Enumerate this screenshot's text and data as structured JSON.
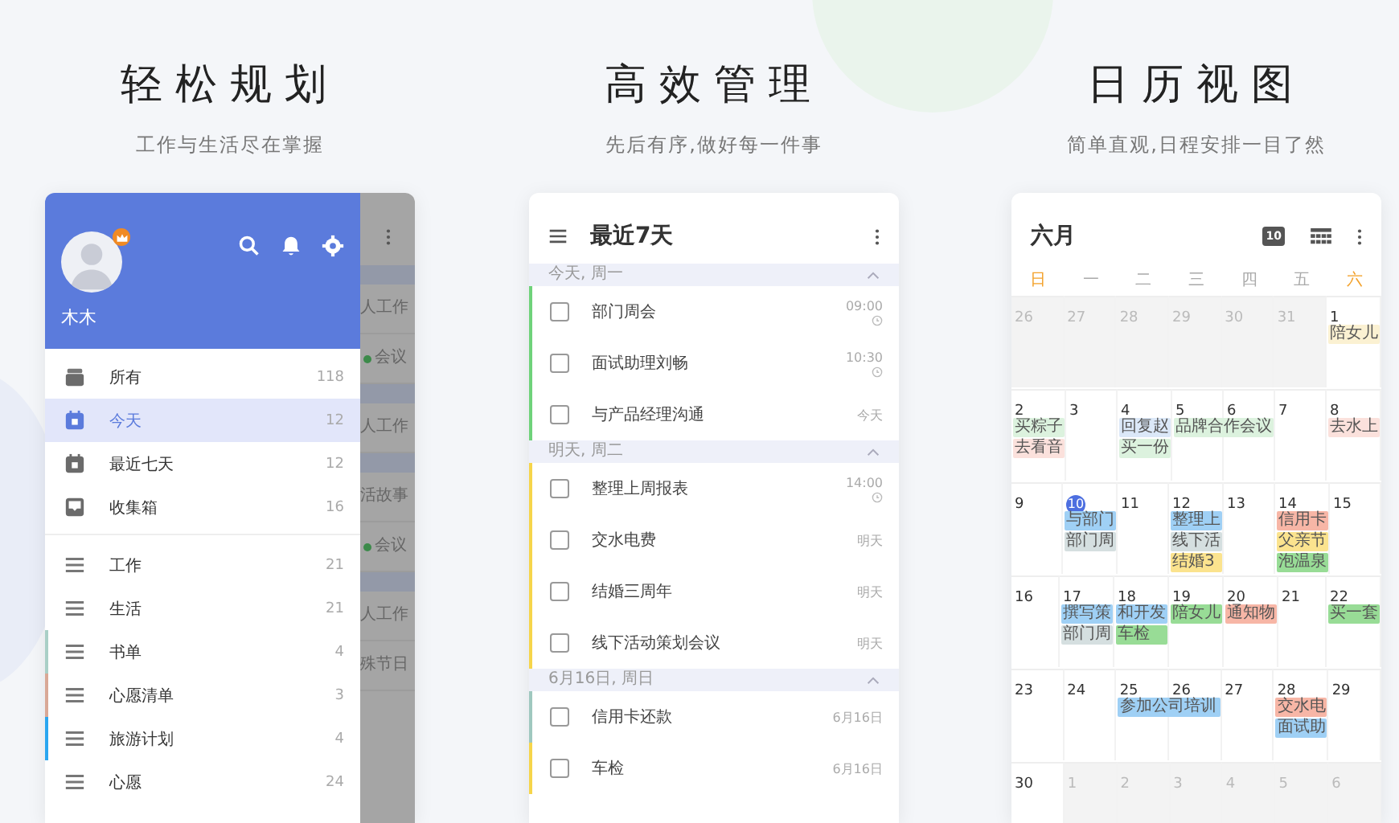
{
  "panels": [
    {
      "title": "轻松规划",
      "subtitle": "工作与生活尽在掌握"
    },
    {
      "title": "高效管理",
      "subtitle": "先后有序,做好每一件事"
    },
    {
      "title": "日历视图",
      "subtitle": "简单直观,日程安排一目了然"
    }
  ],
  "drawer": {
    "user_name": "木木",
    "premium_badge": true,
    "items": [
      {
        "kind": "tray",
        "label": "所有",
        "count": "118",
        "selected": false
      },
      {
        "kind": "calendar",
        "label": "今天",
        "count": "12",
        "selected": true
      },
      {
        "kind": "calendar",
        "label": "最近七天",
        "count": "12",
        "selected": false
      },
      {
        "kind": "inbox",
        "label": "收集箱",
        "count": "16",
        "selected": false
      }
    ],
    "lists": [
      {
        "label": "工作",
        "count": "21"
      },
      {
        "label": "生活",
        "count": "21"
      },
      {
        "label": "书单",
        "count": "4",
        "color": "#a9cfc6"
      },
      {
        "label": "心愿清单",
        "count": "3",
        "color": "#d9a896"
      },
      {
        "label": "旅游计划",
        "count": "4",
        "color": "#2aa6f0"
      },
      {
        "label": "心愿",
        "count": "24"
      }
    ],
    "behind": [
      {
        "kind": "header"
      },
      {
        "kind": "row",
        "text": "人工作"
      },
      {
        "kind": "tag",
        "text": "会议",
        "color": "#3c8a4a"
      },
      {
        "kind": "header"
      },
      {
        "kind": "row",
        "text": "人工作"
      },
      {
        "kind": "header"
      },
      {
        "kind": "row",
        "text": "活故事"
      },
      {
        "kind": "tag",
        "text": "会议",
        "color": "#3c8a4a"
      },
      {
        "kind": "header"
      },
      {
        "kind": "row",
        "text": "人工作"
      },
      {
        "kind": "row",
        "text": "殊节日"
      }
    ]
  },
  "tasks_view": {
    "title": "最近7天",
    "sections": [
      {
        "title": "今天, 周一",
        "expanded": true,
        "tasks": [
          {
            "title": "部门周会",
            "due": "09:00",
            "reminder": true,
            "checked": false,
            "color": "#6fd27a"
          },
          {
            "title": "面试助理刘畅",
            "due": "10:30",
            "reminder": true,
            "checked": false,
            "color": "#6fd27a"
          },
          {
            "title": "与产品经理沟通",
            "due": "今天",
            "reminder": false,
            "checked": false,
            "color": "#6fd27a"
          }
        ]
      },
      {
        "title": "明天, 周二",
        "expanded": true,
        "tasks": [
          {
            "title": "整理上周报表",
            "due": "14:00",
            "reminder": true,
            "checked": false,
            "color": "#f6d54a"
          },
          {
            "title": "交水电费",
            "due": "明天",
            "reminder": false,
            "checked": false,
            "color": "#f6d54a"
          },
          {
            "title": "结婚三周年",
            "due": "明天",
            "reminder": false,
            "checked": false,
            "color": "#f6d54a"
          },
          {
            "title": "线下活动策划会议",
            "due": "明天",
            "reminder": false,
            "checked": false,
            "color": "#f6d54a"
          }
        ]
      },
      {
        "title": "6月16日, 周日",
        "expanded": true,
        "tasks": [
          {
            "title": "信用卡还款",
            "due": "6月16日",
            "reminder": false,
            "checked": false,
            "color": "#9fc8bf"
          },
          {
            "title": "车检",
            "due": "6月16日",
            "reminder": false,
            "checked": false,
            "color": "#f6d54a"
          }
        ]
      }
    ]
  },
  "calendar": {
    "month": "六月",
    "today_badge": "10",
    "weekdays": [
      {
        "label": "日",
        "weekend": true
      },
      {
        "label": "一",
        "weekend": false
      },
      {
        "label": "二",
        "weekend": false
      },
      {
        "label": "三",
        "weekend": false
      },
      {
        "label": "四",
        "weekend": false
      },
      {
        "label": "五",
        "weekend": false
      },
      {
        "label": "六",
        "weekend": true
      }
    ],
    "weeks": [
      {
        "days": [
          {
            "num": "26",
            "other_month": true
          },
          {
            "num": "27",
            "other_month": true
          },
          {
            "num": "28",
            "other_month": true
          },
          {
            "num": "29",
            "other_month": true
          },
          {
            "num": "30",
            "other_month": true
          },
          {
            "num": "31",
            "other_month": true
          },
          {
            "num": "1",
            "other_month": false,
            "events": [
              {
                "text": "陪女儿",
                "kind": "single",
                "color": "#fbf1d2"
              }
            ]
          }
        ]
      },
      {
        "days": [
          {
            "num": "2",
            "other_month": false,
            "events": [
              {
                "text": "买粽子",
                "kind": "single",
                "color": "#dcf2de"
              },
              {
                "text": "去看音",
                "kind": "single",
                "color": "#fbe1dc"
              }
            ]
          },
          {
            "num": "3",
            "other_month": false
          },
          {
            "num": "4",
            "other_month": false,
            "events": [
              {
                "text": "回复赵",
                "kind": "single",
                "color": "#dbe8f8"
              },
              {
                "text": "买一份",
                "kind": "single",
                "color": "#dcf2de"
              }
            ]
          },
          {
            "num": "5",
            "other_month": false,
            "events": [
              {
                "text": "品牌合作会议",
                "kind": "two_day",
                "color": "#dcf2de"
              }
            ]
          },
          {
            "num": "6",
            "other_month": false
          },
          {
            "num": "7",
            "other_month": false
          },
          {
            "num": "8",
            "other_month": false,
            "events": [
              {
                "text": "去水上",
                "kind": "single",
                "color": "#fbe1dc"
              }
            ]
          }
        ]
      },
      {
        "days": [
          {
            "num": "9",
            "other_month": false
          },
          {
            "num": "10",
            "other_month": false,
            "today": true,
            "events": [
              {
                "text": "与部门",
                "kind": "single",
                "color": "#9fd0f5"
              },
              {
                "text": "部门周",
                "kind": "single",
                "color": "#d5dfe0"
              }
            ]
          },
          {
            "num": "11",
            "other_month": false
          },
          {
            "num": "12",
            "other_month": false,
            "events": [
              {
                "text": "整理上",
                "kind": "single",
                "color": "#9fd0f5"
              },
              {
                "text": "线下活",
                "kind": "single",
                "color": "#d5dfe0"
              },
              {
                "text": "结婚3",
                "kind": "single",
                "color": "#fbe38e"
              }
            ]
          },
          {
            "num": "13",
            "other_month": false
          },
          {
            "num": "14",
            "other_month": false,
            "events": [
              {
                "text": "信用卡",
                "kind": "single",
                "color": "#f7b6a6"
              },
              {
                "text": "父亲节",
                "kind": "single",
                "color": "#fbe38e"
              },
              {
                "text": "泡温泉",
                "kind": "single",
                "color": "#98dc96"
              }
            ]
          },
          {
            "num": "15",
            "other_month": false
          }
        ]
      },
      {
        "days": [
          {
            "num": "16",
            "other_month": false
          },
          {
            "num": "17",
            "other_month": false,
            "events": [
              {
                "text": "撰写策",
                "kind": "single",
                "color": "#9fd0f5"
              },
              {
                "text": "部门周",
                "kind": "single",
                "color": "#d5dfe0"
              }
            ]
          },
          {
            "num": "18",
            "other_month": false,
            "events": [
              {
                "text": "和开发",
                "kind": "single",
                "color": "#9fd0f5"
              },
              {
                "text": "车检",
                "kind": "single",
                "color": "#98dc96"
              }
            ]
          },
          {
            "num": "19",
            "other_month": false,
            "events": [
              {
                "text": "陪女儿",
                "kind": "single",
                "color": "#98dc96"
              }
            ]
          },
          {
            "num": "20",
            "other_month": false,
            "events": [
              {
                "text": "通知物",
                "kind": "single",
                "color": "#f7b6a6"
              }
            ]
          },
          {
            "num": "21",
            "other_month": false
          },
          {
            "num": "22",
            "other_month": false,
            "events": [
              {
                "text": "买一套",
                "kind": "single",
                "color": "#98dc96"
              }
            ]
          }
        ]
      },
      {
        "days": [
          {
            "num": "23",
            "other_month": false
          },
          {
            "num": "24",
            "other_month": false
          },
          {
            "num": "25",
            "other_month": false,
            "events": [
              {
                "text": "参加公司培训",
                "kind": "two_day",
                "color": "#9fd0f5"
              }
            ]
          },
          {
            "num": "26",
            "other_month": false
          },
          {
            "num": "27",
            "other_month": false
          },
          {
            "num": "28",
            "other_month": false,
            "events": [
              {
                "text": "交水电",
                "kind": "single",
                "color": "#f7b6a6"
              },
              {
                "text": "面试助",
                "kind": "single",
                "color": "#9fd0f5"
              }
            ]
          },
          {
            "num": "29",
            "other_month": false
          }
        ]
      },
      {
        "days": [
          {
            "num": "30",
            "other_month": false
          },
          {
            "num": "1",
            "other_month": true
          },
          {
            "num": "2",
            "other_month": true
          },
          {
            "num": "3",
            "other_month": true
          },
          {
            "num": "4",
            "other_month": true
          },
          {
            "num": "5",
            "other_month": true
          },
          {
            "num": "6",
            "other_month": true
          }
        ]
      }
    ]
  }
}
